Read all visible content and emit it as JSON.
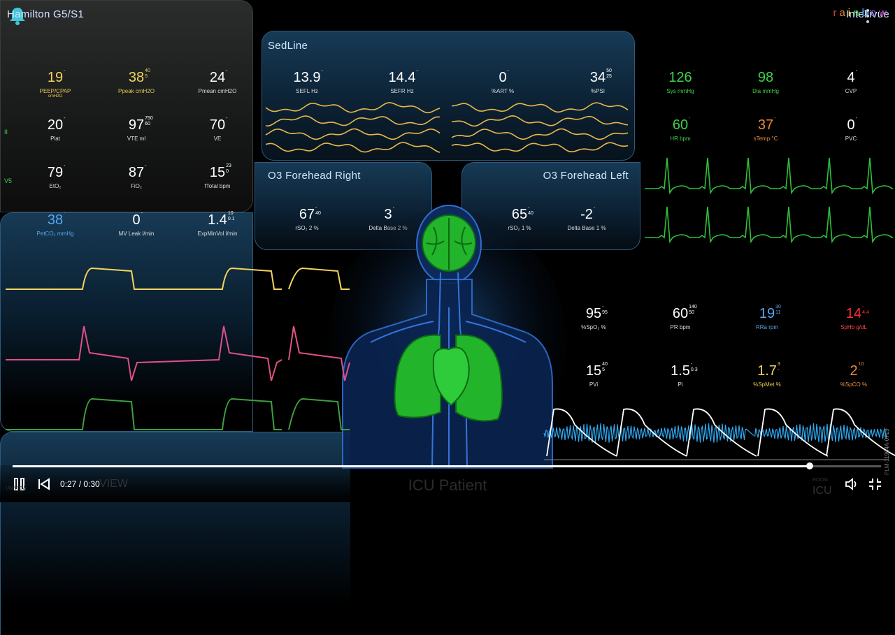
{
  "hamilton": {
    "title": "Hamilton G5/S1",
    "metrics": [
      {
        "value": "19",
        "sup": "-",
        "label": "PEEP/CPAP",
        "label2": "cmH2O",
        "color": "yellow"
      },
      {
        "value": "38",
        "sup": "40\n5",
        "label": "Ppeak cmH2O",
        "color": "yellow"
      },
      {
        "value": "24",
        "sup": "-",
        "label": "Pmean cmH2O",
        "color": "white"
      },
      {
        "value": "20",
        "sup": "-",
        "label": "Plat",
        "color": "white"
      },
      {
        "value": "97",
        "sup": "750\n60",
        "label": "VTE ml",
        "color": "white"
      },
      {
        "value": "70",
        "sup": "-",
        "label": "VE",
        "color": "white"
      },
      {
        "value": "79",
        "sup": "-",
        "label": "EtO₂",
        "color": "white"
      },
      {
        "value": "87",
        "sup": "-",
        "label": "FiO₂",
        "color": "white"
      },
      {
        "value": "15",
        "sup": "23\n0",
        "label": "fTotal bpm",
        "color": "white"
      },
      {
        "value": "38",
        "sup": "-",
        "label": "PetCO₂ mmHg",
        "color": "blue"
      },
      {
        "value": "0",
        "sup": "-",
        "label": "MV Leak l/min",
        "color": "white"
      },
      {
        "value": "1.4",
        "sup": "10\n0.1",
        "label": "ExpMinVol l/min",
        "color": "white"
      }
    ]
  },
  "sedline": {
    "title": "SedLine",
    "metrics": [
      {
        "value": "13.9",
        "sup": "-",
        "label": "SEFL Hz"
      },
      {
        "value": "14.4",
        "sup": "-",
        "label": "SEFR Hz"
      },
      {
        "value": "0",
        "sup": "-",
        "label": "%ART %"
      },
      {
        "value": "34",
        "sup": "50\n25",
        "label": "%PSI"
      }
    ]
  },
  "o3_right": {
    "title": "O3 Forehead Right",
    "metrics": [
      {
        "value": "67",
        "sup": "-\n40",
        "label": "rSO₂ 2 %"
      },
      {
        "value": "3",
        "sup": "-",
        "label": "Delta Base 2 %"
      }
    ]
  },
  "o3_left": {
    "title": "O3 Forehead Left",
    "metrics": [
      {
        "value": "65",
        "sup": "-\n40",
        "label": "rSO₂ 1 %"
      },
      {
        "value": "-2",
        "sup": "-",
        "label": "Delta Base 1 %"
      }
    ]
  },
  "intellivue": {
    "title": "Intellivue",
    "metrics": [
      {
        "value": "126",
        "sup": "-",
        "label": "Sys mmHg",
        "color": "green"
      },
      {
        "value": "98",
        "sup": "-",
        "label": "Dia mmHg",
        "color": "green"
      },
      {
        "value": "4",
        "sup": "-",
        "label": "CVP",
        "color": "white"
      },
      {
        "value": "60",
        "sup": "-",
        "label": "HR bpm",
        "color": "green"
      },
      {
        "value": "37",
        "sup": "-",
        "label": "sTemp °C",
        "color": "orange"
      },
      {
        "value": "0",
        "sup": "-",
        "label": "PVC",
        "color": "white"
      }
    ],
    "lead_1": "II",
    "lead_2": "V5"
  },
  "rainbow": {
    "title": "rainbow",
    "title_colors": [
      "#e04040",
      "#f08a3a",
      "#f2d45c",
      "#3ed24a",
      "#5aa7f0",
      "#8a6cf0",
      "#d060d0"
    ],
    "metrics": [
      {
        "value": "95",
        "sup": "-\n95",
        "label": "%SpO₂ %",
        "color": "white"
      },
      {
        "value": "60",
        "sup": "140\n50",
        "label": "PR bpm",
        "color": "white"
      },
      {
        "value": "19",
        "sup": "30\n11",
        "label": "RRa rpm",
        "color": "blue"
      },
      {
        "value": "14",
        "sup": "-\n4.4",
        "label": "SpHb g/dL",
        "color": "red"
      },
      {
        "value": "15",
        "sup": "40\n5",
        "label": "PVi",
        "color": "white"
      },
      {
        "value": "1.5",
        "sup": "-\n0.3",
        "label": "Pi",
        "color": "white"
      },
      {
        "value": "1.7",
        "sup": "3\n-",
        "label": "%SpMet %",
        "color": "yellow"
      },
      {
        "value": "2",
        "sup": "10\n-",
        "label": "%SpCO %",
        "color": "orange"
      }
    ]
  },
  "side_text": "PLM-11964A-0719",
  "colors": {
    "yellow": "#f2d45c",
    "pink": "#e0508a",
    "green": "#3ea03e",
    "ecg": "#2fbf3a",
    "eeg": "#e9b84a",
    "pleth": "#2fa8f0"
  },
  "video": {
    "time": "0:27 / 0:30",
    "progress": 0.918,
    "caption_center": "ICU Patient",
    "caption_left": "VIEW",
    "caption_right": "ICU",
    "room_label": "ROOM",
    "brand": "UNIVIEW"
  },
  "icons": {
    "top_left": "bell-icon",
    "top_right": "more-vertical-icon",
    "pause": "pause-icon",
    "prev": "skip-previous-icon",
    "volume": "volume-icon",
    "exit_full": "exit-fullscreen-icon"
  }
}
